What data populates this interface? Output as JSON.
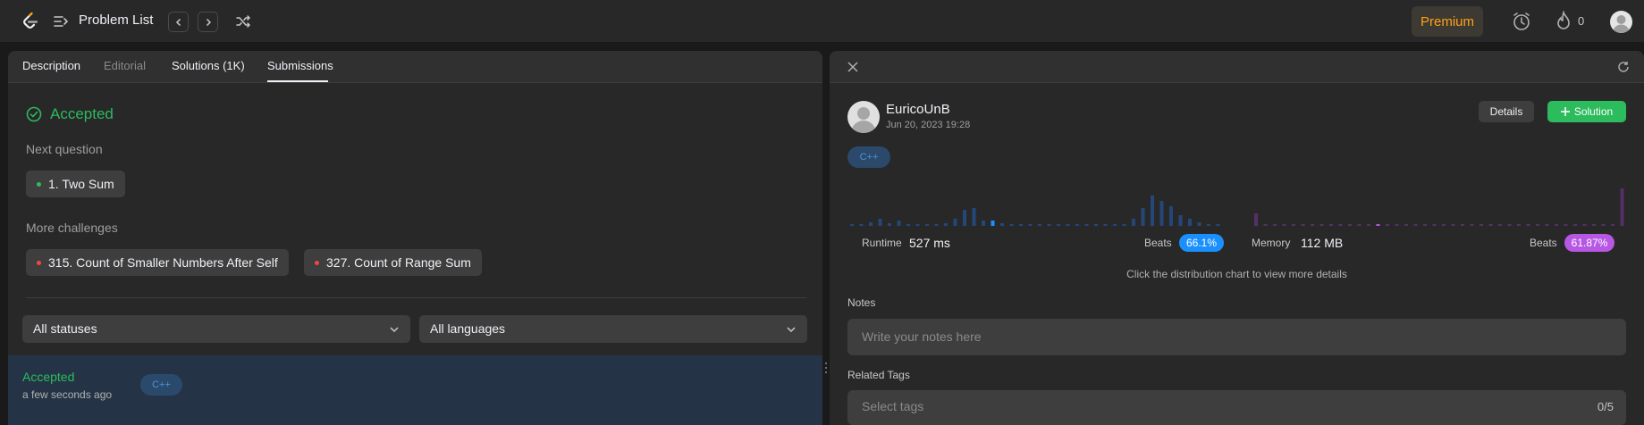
{
  "topnav": {
    "title": "Problem List",
    "premium_label": "Premium",
    "streak_count": "0",
    "icons": [
      "leetcode-logo",
      "list-icon",
      "chevron-left-icon",
      "chevron-right-icon",
      "shuffle-icon",
      "alarm-icon",
      "fire-icon",
      "avatar"
    ]
  },
  "left": {
    "tabs": [
      "Description",
      "Editorial",
      "Solutions (1K)",
      "Submissions"
    ],
    "active_tab": "Submissions",
    "status": "Accepted",
    "next_question_label": "Next question",
    "next_question": "1. Two Sum",
    "more_challenges_label": "More challenges",
    "challenges": [
      "315. Count of Smaller Numbers After Self",
      "327. Count of Range Sum"
    ],
    "filter_status": "All statuses",
    "filter_language": "All languages",
    "submission": {
      "status": "Accepted",
      "time": "a few seconds ago",
      "language": "C++"
    }
  },
  "right": {
    "user": "EuricoUnB",
    "date": "Jun 20, 2023 19:28",
    "details_label": "Details",
    "solution_label": "Solution",
    "language": "C++",
    "runtime": {
      "label": "Runtime",
      "value": "527 ms",
      "beats_label": "Beats",
      "beats": "66.1%"
    },
    "memory": {
      "label": "Memory",
      "value": "112 MB",
      "beats_label": "Beats",
      "beats": "61.87%"
    },
    "hint": "Click the distribution chart to view more details",
    "notes_label": "Notes",
    "notes_placeholder": "Write your notes here",
    "tags_label": "Related Tags",
    "tags_placeholder": "Select tags",
    "tags_count": "0/5"
  },
  "colors": {
    "accent_green": "#2cbb5d",
    "runtime_blue": "#1a90ff",
    "memory_purple": "#b757e4",
    "premium_orange": "#ffa116"
  }
}
